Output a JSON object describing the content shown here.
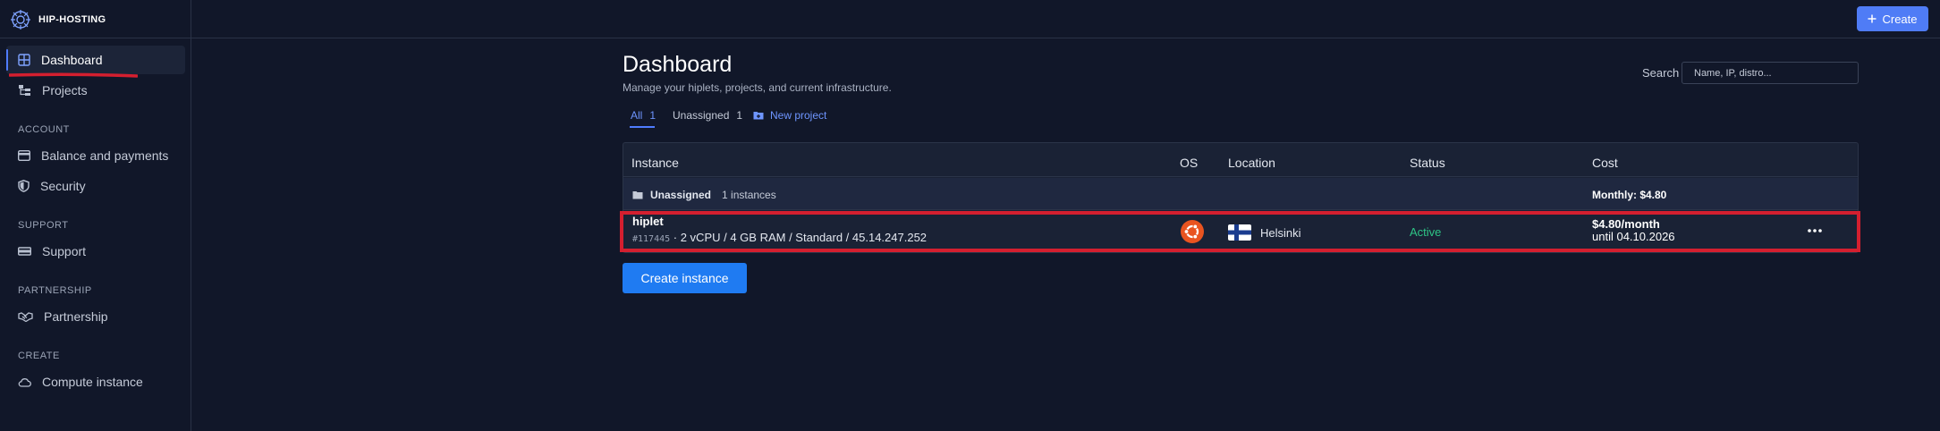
{
  "app": {
    "name": "HIP-HOSTING"
  },
  "sidebar": {
    "items": [
      {
        "label": "Dashboard",
        "icon": "grid-icon",
        "active": true
      },
      {
        "label": "Projects",
        "icon": "tree-icon"
      }
    ],
    "sections": [
      {
        "label": "ACCOUNT",
        "items": [
          {
            "label": "Balance and payments",
            "icon": "wallet-icon"
          },
          {
            "label": "Security",
            "icon": "shield-icon"
          }
        ]
      },
      {
        "label": "SUPPORT",
        "items": [
          {
            "label": "Support",
            "icon": "support-icon"
          }
        ]
      },
      {
        "label": "PARTNERSHIP",
        "items": [
          {
            "label": "Partnership",
            "icon": "handshake-icon"
          }
        ]
      },
      {
        "label": "CREATE",
        "items": [
          {
            "label": "Compute instance",
            "icon": "cloud-icon"
          }
        ]
      }
    ]
  },
  "topbar": {
    "create_label": "Create"
  },
  "main": {
    "title": "Dashboard",
    "subtitle": "Manage your hiplets, projects, and current infrastructure.",
    "search": {
      "label": "Search",
      "placeholder": "Name, IP, distro..."
    },
    "tabs": [
      {
        "label": "All",
        "count": "1",
        "active": true
      },
      {
        "label": "Unassigned",
        "count": "1"
      }
    ],
    "new_project_label": "New project",
    "table": {
      "columns": [
        "Instance",
        "OS",
        "Location",
        "Status",
        "Cost"
      ],
      "group": {
        "name": "Unassigned",
        "count_text": "1 instances",
        "monthly": "Monthly: $4.80"
      },
      "rows": [
        {
          "name": "hiplet",
          "id": "#117445",
          "details": " · 2 vCPU / 4 GB RAM / Standard / 45.14.247.252",
          "os_icon": "ubuntu-icon",
          "location": "Helsinki",
          "flag_icon": "finland-flag-icon",
          "status": "Active",
          "price": "$4.80/month",
          "until": "until 04.10.2026"
        }
      ]
    },
    "create_instance_label": "Create instance"
  },
  "colors": {
    "accent": "#4f7cf6",
    "status_active": "#2ec486",
    "highlight": "#d41f2f",
    "background": "#111729"
  }
}
